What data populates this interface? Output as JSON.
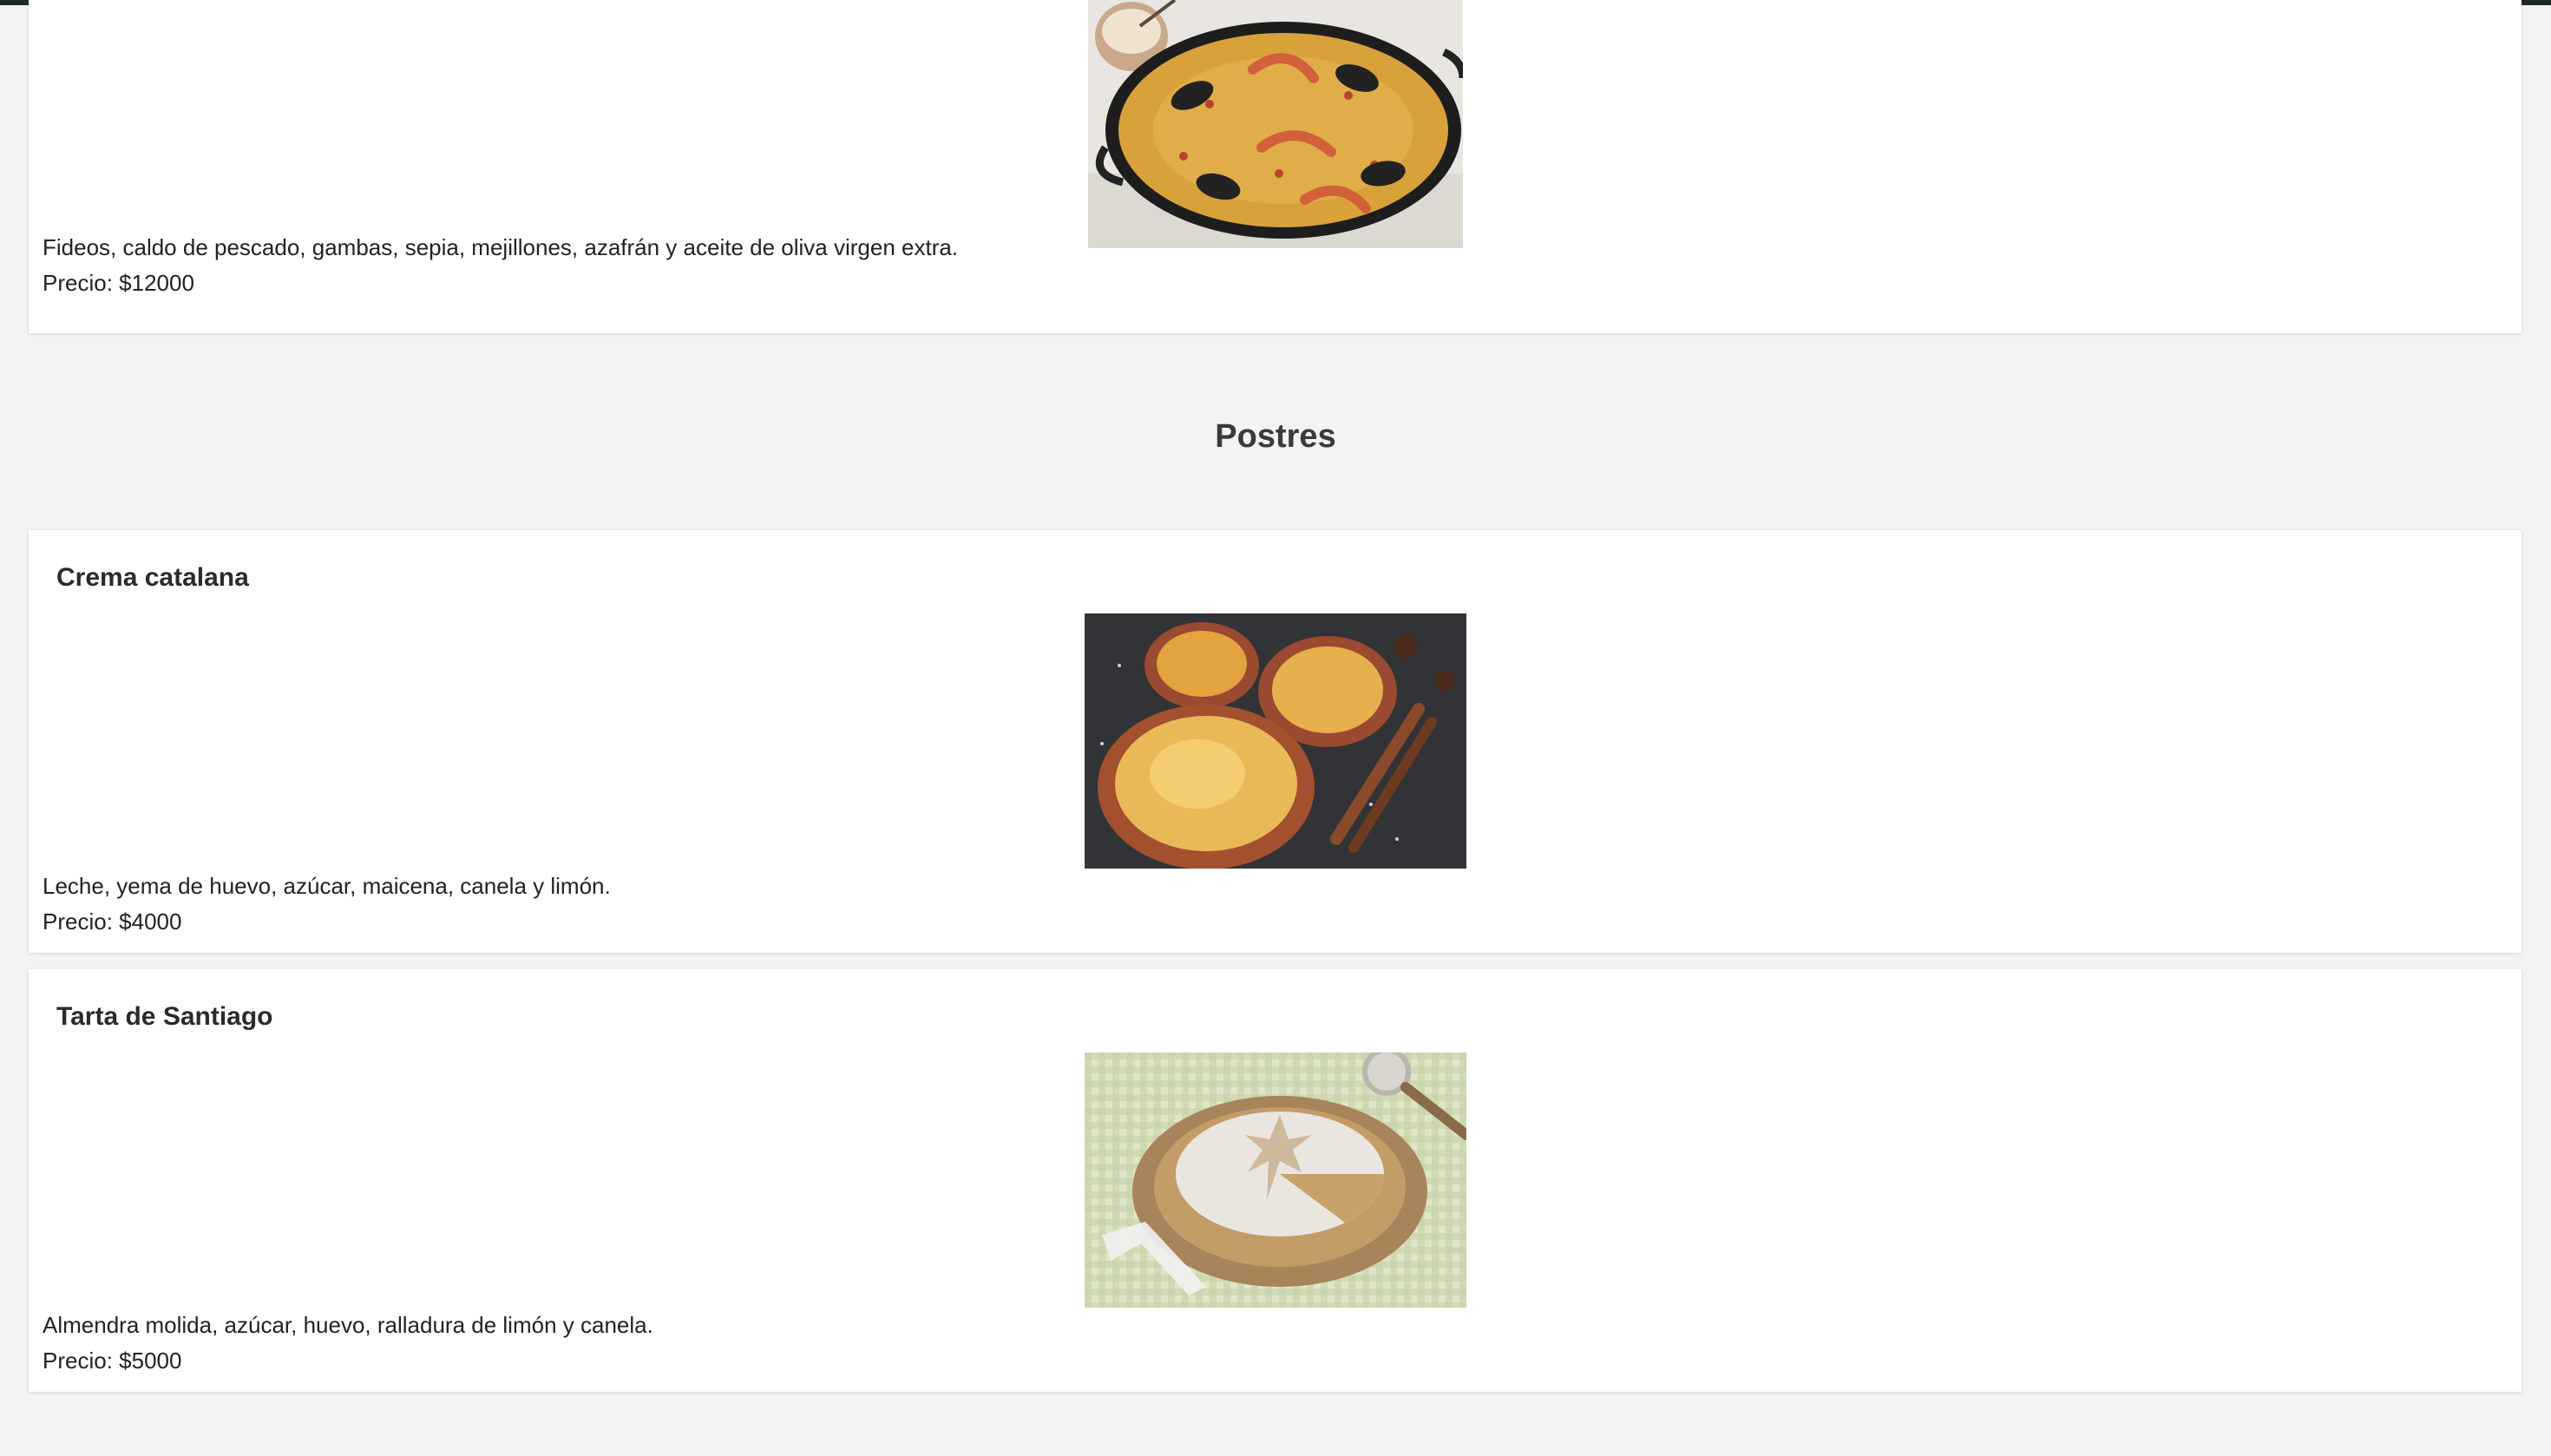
{
  "colors": {
    "page_background": "#f3f3f3",
    "card_background": "#ffffff",
    "top_strip": "#1f2a26"
  },
  "cards": [
    {
      "title": "",
      "image": "paella-image",
      "description": "Fideos, caldo de pescado, gambas, sepia, mejillones, azafrán y aceite de oliva virgen extra.",
      "price": "Precio: $12000"
    },
    {
      "title": "Crema catalana",
      "image": "crema-catalana-image",
      "description": "Leche, yema de huevo, azúcar, maicena, canela y limón.",
      "price": "Precio: $4000"
    },
    {
      "title": "Tarta de Santiago",
      "image": "tarta-de-santiago-image",
      "description": "Almendra molida, azúcar, huevo, ralladura de limón y canela.",
      "price": "Precio: $5000"
    }
  ],
  "section": {
    "heading": "Postres"
  }
}
